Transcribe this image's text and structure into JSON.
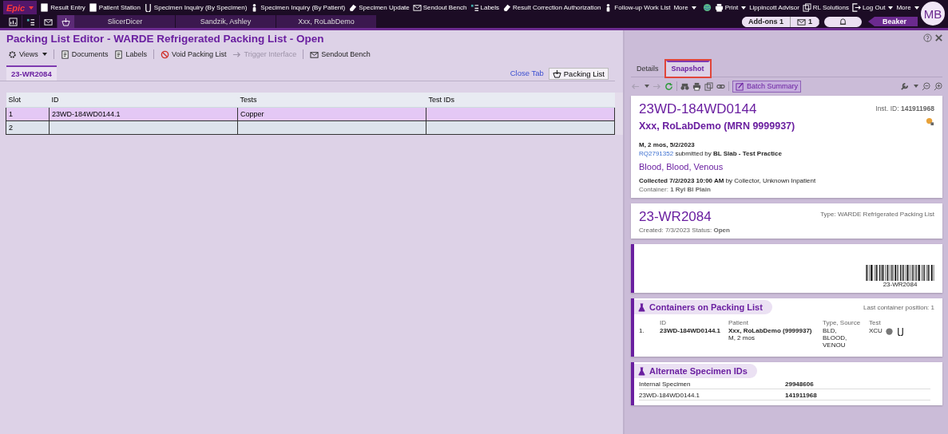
{
  "app_menu": {
    "label": "Epic"
  },
  "activities": [
    {
      "label": "Result Entry"
    },
    {
      "label": "Patient Station"
    },
    {
      "label": "Specimen Inquiry (By Specimen)"
    },
    {
      "label": "Specimen Inquiry (By Patient)"
    },
    {
      "label": "Specimen Update"
    },
    {
      "label": "Sendout Bench"
    },
    {
      "label": "Labels"
    },
    {
      "label": "Result Correction Authorization"
    },
    {
      "label": "Follow-up Work List"
    },
    {
      "label": "More"
    }
  ],
  "right_menu": [
    {
      "label": "Print",
      "kind": "menu"
    },
    {
      "label": "Lippincott Advisor",
      "kind": "link"
    },
    {
      "label": "RL Solutions",
      "kind": "link"
    },
    {
      "label": "Log Out",
      "kind": "menu"
    },
    {
      "label": "More",
      "kind": "menu"
    }
  ],
  "icon_buttons": [
    {
      "selected": false
    },
    {
      "selected": false
    },
    {
      "selected": false
    },
    {
      "selected": true
    }
  ],
  "workspace_tabs": [
    {
      "label": "SlicerDicer",
      "selected": false
    },
    {
      "label": "Sandzik, Ashley",
      "selected": false
    },
    {
      "label": "Xxx, RoLabDemo",
      "selected": false
    }
  ],
  "addons": {
    "label": "Add-ons",
    "count": "1"
  },
  "inbasket": {
    "count": "1"
  },
  "app_name": "Beaker",
  "avatar": "MB",
  "title": "Packing List Editor - WARDE Refrigerated Packing List - Open",
  "toolbar": [
    {
      "label": "Views",
      "kind": "menu",
      "disabled": false
    },
    {
      "label": "Documents",
      "kind": "button",
      "disabled": false
    },
    {
      "label": "Labels",
      "kind": "button",
      "disabled": false
    },
    {
      "label": "Void Packing List",
      "kind": "button",
      "disabled": false
    },
    {
      "label": "Trigger Interface",
      "kind": "button",
      "disabled": true
    },
    {
      "label": "Sendout Bench",
      "kind": "button",
      "disabled": false
    }
  ],
  "doc_tabs": [
    {
      "label": "23-WR2084",
      "selected": true
    }
  ],
  "close_tab": "Close Tab",
  "packing_list_button": "Packing List",
  "table": {
    "columns": [
      "Slot",
      "ID",
      "Tests",
      "Test IDs"
    ],
    "rows": [
      {
        "slot": "1",
        "id": "23WD-184WD0144.1",
        "tests": "Copper",
        "selected": true
      },
      {
        "slot": "2",
        "selected": false
      }
    ]
  },
  "side_tabs": [
    {
      "label": "Details",
      "selected": false,
      "highlighted": false
    },
    {
      "label": "Snapshot",
      "selected": true,
      "highlighted": true
    }
  ],
  "batch_summary": "Batch Summary",
  "specimen": {
    "id": "23WD-184WD0144",
    "inst_id": "Inst. ID: **141911968**",
    "patient": "Xxx, RoLabDemo (MRN 9999937)",
    "demographics": "M, 2 mos, 5/2/2023",
    "order_link": "RQ2791352",
    "submitted": "submitted by **BL Slab - Test Practice**",
    "source": "Blood, Blood, Venous",
    "collected": "**Collected 7/2/2023 10:00 AM** by Collector, Unknown Inpatient",
    "container": "Container: **1 Ryl Bl Plain**"
  },
  "packing_list": {
    "id": "23-WR2084",
    "type": "Type: WARDE Refrigerated Packing List",
    "created": "Created: 7/3/2023  Status: **Open**"
  },
  "barcode": {
    "label": "23-WR2084"
  },
  "containers": {
    "title": "Containers on Packing List",
    "last_position": "Last container position: 1",
    "columns": [
      "ID",
      "Patient",
      "Type, Source",
      "Test"
    ],
    "rows": [
      {
        "number": "1.",
        "id": "23WD-184WD0144.1",
        "patient": "Xxx, RoLabDemo (9999937)",
        "patient_detail": "M, 2 mos",
        "type_source": "BLD,\nBLOOD,\nVENOU",
        "test": "XCU"
      }
    ]
  },
  "alt_ids": {
    "title": "Alternate Specimen IDs",
    "rows": [
      {
        "label": "Internal Specimen",
        "value": "29948606"
      },
      {
        "label": "23WD-184WD0144.1",
        "value": "141911968"
      }
    ]
  }
}
